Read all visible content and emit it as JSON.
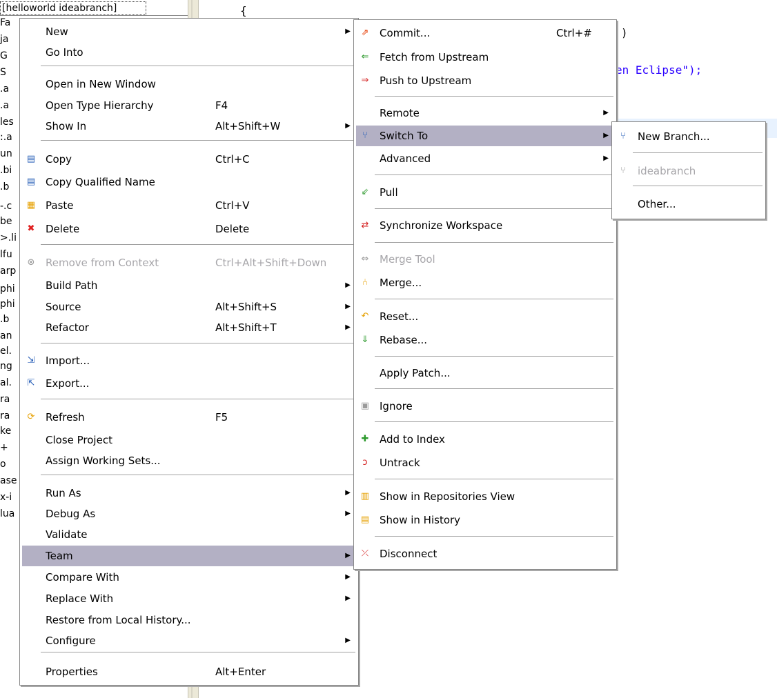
{
  "explorer": {
    "header_text": "[helloworld ideabranch]",
    "fragments": [
      "Fa",
      "ja",
      "G",
      "S",
      ".a",
      ".a",
      "les",
      ":.a",
      "un",
      ".bi",
      ".b",
      "-.c",
      "be",
      ">.li",
      "lfu",
      "arp",
      "phi",
      "phi",
      ".b",
      "an",
      "el.",
      "ng",
      "al.",
      "ra",
      "ra",
      "ke",
      "+",
      "o",
      "ase",
      "x-i",
      "lua"
    ]
  },
  "editor": {
    "lines": [
      {
        "text": "{",
        "string": false
      },
      {
        "text": ")",
        "string": false
      },
      {
        "text": "en Eclipse\");",
        "string": true
      }
    ]
  },
  "main_menu": {
    "items": [
      {
        "label": "New",
        "shortcut": "",
        "submenu": true,
        "icon": ""
      },
      {
        "label": "Go Into",
        "shortcut": "",
        "submenu": false,
        "icon": ""
      },
      {
        "label": "Open in New Window",
        "shortcut": "",
        "submenu": false,
        "icon": ""
      },
      {
        "label": "Open Type Hierarchy",
        "shortcut": "F4",
        "submenu": false,
        "icon": ""
      },
      {
        "label": "Show In",
        "shortcut": "Alt+Shift+W",
        "submenu": true,
        "icon": ""
      },
      {
        "label": "Copy",
        "shortcut": "Ctrl+C",
        "submenu": false,
        "icon": "copy-icon"
      },
      {
        "label": "Copy Qualified Name",
        "shortcut": "",
        "submenu": false,
        "icon": "copy-qualified-name-icon"
      },
      {
        "label": "Paste",
        "shortcut": "Ctrl+V",
        "submenu": false,
        "icon": "paste-icon"
      },
      {
        "label": "Delete",
        "shortcut": "Delete",
        "submenu": false,
        "icon": "delete-icon"
      },
      {
        "label": "Remove from Context",
        "shortcut": "Ctrl+Alt+Shift+Down",
        "submenu": false,
        "icon": "remove-context-icon",
        "disabled": true
      },
      {
        "label": "Build Path",
        "shortcut": "",
        "submenu": true,
        "icon": ""
      },
      {
        "label": "Source",
        "shortcut": "Alt+Shift+S",
        "submenu": true,
        "icon": ""
      },
      {
        "label": "Refactor",
        "shortcut": "Alt+Shift+T",
        "submenu": true,
        "icon": ""
      },
      {
        "label": "Import...",
        "shortcut": "",
        "submenu": false,
        "icon": "import-icon"
      },
      {
        "label": "Export...",
        "shortcut": "",
        "submenu": false,
        "icon": "export-icon"
      },
      {
        "label": "Refresh",
        "shortcut": "F5",
        "submenu": false,
        "icon": "refresh-icon"
      },
      {
        "label": "Close Project",
        "shortcut": "",
        "submenu": false,
        "icon": ""
      },
      {
        "label": "Assign Working Sets...",
        "shortcut": "",
        "submenu": false,
        "icon": ""
      },
      {
        "label": "Run As",
        "shortcut": "",
        "submenu": true,
        "icon": ""
      },
      {
        "label": "Debug As",
        "shortcut": "",
        "submenu": true,
        "icon": ""
      },
      {
        "label": "Validate",
        "shortcut": "",
        "submenu": false,
        "icon": ""
      },
      {
        "label": "Team",
        "shortcut": "",
        "submenu": true,
        "icon": "",
        "highlighted": true
      },
      {
        "label": "Compare With",
        "shortcut": "",
        "submenu": true,
        "icon": ""
      },
      {
        "label": "Replace With",
        "shortcut": "",
        "submenu": true,
        "icon": ""
      },
      {
        "label": "Restore from Local History...",
        "shortcut": "",
        "submenu": false,
        "icon": ""
      },
      {
        "label": "Configure",
        "shortcut": "",
        "submenu": true,
        "icon": ""
      },
      {
        "label": "Properties",
        "shortcut": "Alt+Enter",
        "submenu": false,
        "icon": ""
      }
    ]
  },
  "team_menu": {
    "items": [
      {
        "label": "Commit...",
        "shortcut": "Ctrl+#",
        "submenu": false,
        "icon": "commit-icon"
      },
      {
        "label": "Fetch from Upstream",
        "shortcut": "",
        "submenu": false,
        "icon": "fetch-icon"
      },
      {
        "label": "Push to Upstream",
        "shortcut": "",
        "submenu": false,
        "icon": "push-icon"
      },
      {
        "label": "Remote",
        "shortcut": "",
        "submenu": true,
        "icon": ""
      },
      {
        "label": "Switch To",
        "shortcut": "",
        "submenu": true,
        "icon": "switch-branch-icon",
        "highlighted": true
      },
      {
        "label": "Advanced",
        "shortcut": "",
        "submenu": true,
        "icon": ""
      },
      {
        "label": "Pull",
        "shortcut": "",
        "submenu": false,
        "icon": "pull-icon"
      },
      {
        "label": "Synchronize Workspace",
        "shortcut": "",
        "submenu": false,
        "icon": "synchronize-icon"
      },
      {
        "label": "Merge Tool",
        "shortcut": "",
        "submenu": false,
        "icon": "merge-tool-icon",
        "disabled": true
      },
      {
        "label": "Merge...",
        "shortcut": "",
        "submenu": false,
        "icon": "merge-icon"
      },
      {
        "label": "Reset...",
        "shortcut": "",
        "submenu": false,
        "icon": "reset-icon"
      },
      {
        "label": "Rebase...",
        "shortcut": "",
        "submenu": false,
        "icon": "rebase-icon"
      },
      {
        "label": "Apply Patch...",
        "shortcut": "",
        "submenu": false,
        "icon": ""
      },
      {
        "label": "Ignore",
        "shortcut": "",
        "submenu": false,
        "icon": "ignore-icon"
      },
      {
        "label": "Add to Index",
        "shortcut": "",
        "submenu": false,
        "icon": "add-to-index-icon"
      },
      {
        "label": "Untrack",
        "shortcut": "",
        "submenu": false,
        "icon": "untrack-icon"
      },
      {
        "label": "Show in Repositories View",
        "shortcut": "",
        "submenu": false,
        "icon": "repositories-icon"
      },
      {
        "label": "Show in History",
        "shortcut": "",
        "submenu": false,
        "icon": "history-icon"
      },
      {
        "label": "Disconnect",
        "shortcut": "",
        "submenu": false,
        "icon": "disconnect-icon"
      }
    ]
  },
  "switch_menu": {
    "items": [
      {
        "label": "New Branch...",
        "icon": "new-branch-icon"
      },
      {
        "label": "ideabranch",
        "icon": "branch-icon",
        "disabled": true
      },
      {
        "label": "Other...",
        "icon": ""
      }
    ]
  }
}
